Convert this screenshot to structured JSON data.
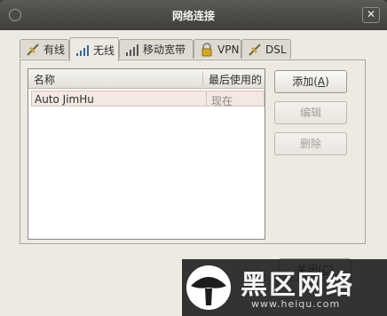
{
  "window": {
    "title": "网络连接"
  },
  "tabs": [
    {
      "label": "有线",
      "icon": "wired-icon"
    },
    {
      "label": "无线",
      "icon": "wireless-icon"
    },
    {
      "label": "移动宽带",
      "icon": "mobile-broadband-icon"
    },
    {
      "label": "VPN",
      "icon": "lock-icon"
    },
    {
      "label": "DSL",
      "icon": "dsl-icon"
    }
  ],
  "active_tab": "无线",
  "list": {
    "columns": [
      "名称",
      "最后使用的"
    ],
    "rows": [
      {
        "name": "Auto JimHu",
        "last_used": "现在"
      }
    ]
  },
  "buttons": {
    "add": "添加",
    "add_key": "A",
    "edit": "编辑",
    "delete": "删除",
    "close": "关闭",
    "close_key": "C"
  },
  "watermark": {
    "text": "黑区网络",
    "url": "www.heiqu.com"
  }
}
